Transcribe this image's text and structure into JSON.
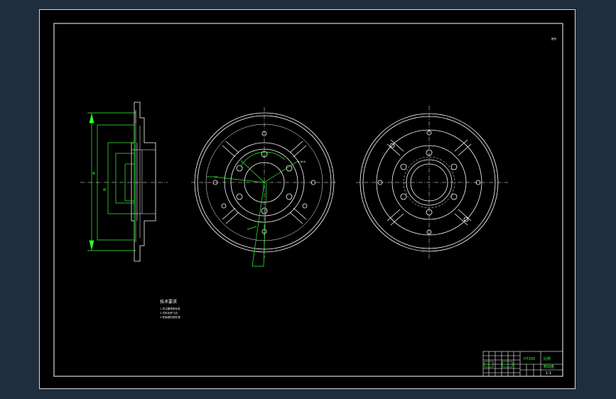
{
  "sheet": {
    "corner_tag": "图号"
  },
  "technical_requirements": {
    "title": "技术要求",
    "items": [
      "1.未注圆角按标准",
      "2.去除毛刺飞边",
      "3.表面做防锈处理"
    ]
  },
  "dimensions": {
    "front_view": [
      "Φ",
      "Φ"
    ],
    "hole_note": "6-Φ16"
  },
  "title_block": {
    "material": "HT200",
    "part_name": "制动盘",
    "scale": "1:1",
    "sheet_label": "比例"
  },
  "colors": {
    "background": "#1f2d3d",
    "sheet": "#000000",
    "outline": "#ffffff",
    "dimension": "#33ff33",
    "border": "#d8d8d8"
  }
}
